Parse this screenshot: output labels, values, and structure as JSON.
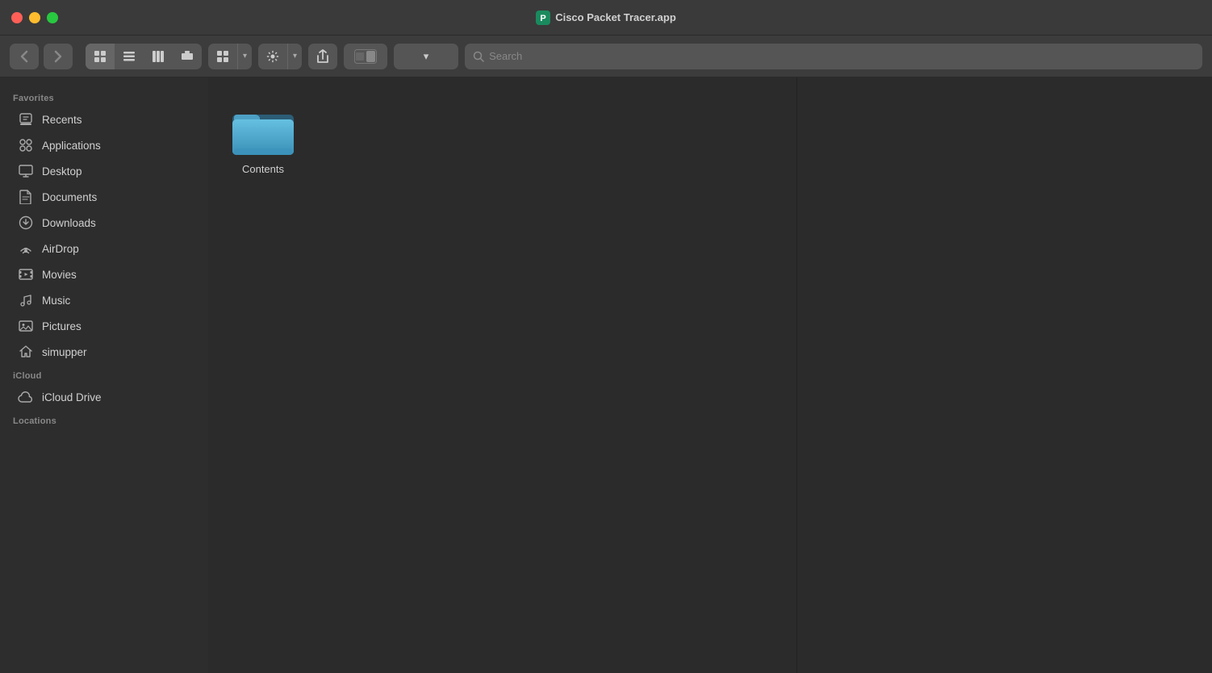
{
  "window": {
    "title": "Cisco Packet Tracer.app",
    "controls": {
      "close": "close",
      "minimize": "minimize",
      "maximize": "maximize"
    }
  },
  "toolbar": {
    "back_label": "‹",
    "forward_label": "›",
    "view_icon_grid": "⊞",
    "view_icon_list": "≡",
    "view_icon_column": "⫿",
    "view_icon_cover": "⊟",
    "view_dropdown_label": "⊞",
    "gear_label": "⚙",
    "share_label": "↑",
    "toggle_label": "◉",
    "tag_dropdown_label": "▾",
    "search_placeholder": "Search"
  },
  "sidebar": {
    "sections": [
      {
        "name": "Favorites",
        "items": [
          {
            "id": "recents",
            "label": "Recents",
            "icon": "recents"
          },
          {
            "id": "applications",
            "label": "Applications",
            "icon": "applications"
          },
          {
            "id": "desktop",
            "label": "Desktop",
            "icon": "desktop"
          },
          {
            "id": "documents",
            "label": "Documents",
            "icon": "documents"
          },
          {
            "id": "downloads",
            "label": "Downloads",
            "icon": "downloads"
          },
          {
            "id": "airdrop",
            "label": "AirDrop",
            "icon": "airdrop"
          },
          {
            "id": "movies",
            "label": "Movies",
            "icon": "movies"
          },
          {
            "id": "music",
            "label": "Music",
            "icon": "music"
          },
          {
            "id": "pictures",
            "label": "Pictures",
            "icon": "pictures"
          },
          {
            "id": "simupper",
            "label": "simupper",
            "icon": "home"
          }
        ]
      },
      {
        "name": "iCloud",
        "items": [
          {
            "id": "icloud-drive",
            "label": "iCloud Drive",
            "icon": "icloud"
          }
        ]
      },
      {
        "name": "Locations",
        "items": []
      }
    ]
  },
  "file_pane": {
    "items": [
      {
        "id": "contents",
        "label": "Contents",
        "type": "folder"
      }
    ]
  }
}
